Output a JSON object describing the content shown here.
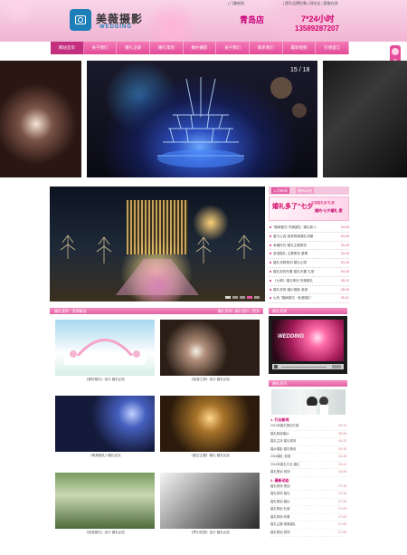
{
  "header": {
    "brand_cn": "美薇摄影",
    "brand_en": "WEDDING",
    "top_link": "| 门最新网",
    "top_right": "| 提升品牌形象 | 网站全 | 客服在线",
    "store": "青岛店",
    "hotline_label": "7*24小时",
    "hotline_number": "13589287207"
  },
  "nav": [
    "网站首页",
    "关于我们",
    "婚礼记录",
    "婚礼策划",
    "婚纱摄影",
    "关于我们",
    "联系我们",
    "最新视频",
    "在线留言"
  ],
  "side_float": {
    "label": "在线客服"
  },
  "gallery": {
    "counter": "15 / 18"
  },
  "right_tabs": [
    "公司新闻",
    "最新动态"
  ],
  "promo": {
    "main": "婚礼多了\"七夕",
    "sub": "中国婚礼新\"礼服",
    "tag": "婚约·七夕婚礼·爱"
  },
  "news": [
    {
      "title": "\"婚嫁盛况·完美婚礼\" 婚礼新人",
      "date": "04-26"
    },
    {
      "title": "爱与心连·浪漫唯美婚礼场景",
      "date": "04-20"
    },
    {
      "title": "幸福时光·婚礼主题策划",
      "date": "04-18"
    },
    {
      "title": "浪漫婚礼·主题策划 爱情",
      "date": "04-16"
    },
    {
      "title": "婚礼流程策划·婚礼记录",
      "date": "04-15"
    },
    {
      "title": "婚礼现场布置·婚礼布置 礼堂",
      "date": "04-15"
    },
    {
      "title": "《大美》婚礼策划 完美婚礼",
      "date": "05-11"
    },
    {
      "title": "婚礼现场·婚纱摄影 浪漫",
      "date": "05-03"
    },
    {
      "title": "火热 \"婚嫁盛况 · 浪漫婚礼\"",
      "date": "05-01"
    }
  ],
  "cases": {
    "title": "婚礼案例 · 案例精选",
    "tabs": [
      "婚礼案例",
      "婚礼图片",
      "更多"
    ],
    "items": [
      {
        "caption": "《美好婚礼》设计·婚礼纪实"
      },
      {
        "caption": "《浪漫之夜》设计·婚礼纪实"
      },
      {
        "caption": "《唯美婚礼》·婚礼纪实"
      },
      {
        "caption": "《星空主题》婚礼·婚礼纪实"
      },
      {
        "caption": "《浪漫婚礼》设计·婚礼纪实"
      },
      {
        "caption": "《梦幻花园》设计·婚礼纪实"
      }
    ]
  },
  "video": {
    "title": "婚礼视频",
    "label": "WEDDING"
  },
  "right_panel": {
    "title": "婚礼资讯",
    "groups": [
      {
        "heading": "1. 行业新闻",
        "items": [
          {
            "title": "2013年婚礼策划方案",
            "date": "09-12"
          },
          {
            "title": "婚礼精品婚纱",
            "date": "06-26"
          },
          {
            "title": "婚礼主持·婚礼现场",
            "date": "04-23"
          },
          {
            "title": "婚纱摄影·婚礼策划",
            "date": "04-19"
          },
          {
            "title": "2016婚礼·浪漫",
            "date": "04-16"
          },
          {
            "title": "2016年婚礼行业·婚礼",
            "date": "04-12"
          },
          {
            "title": "婚礼策划·现场",
            "date": "04-09"
          }
        ]
      },
      {
        "heading": "2. 最新动态",
        "items": [
          {
            "title": "婚礼现场·策划",
            "date": "07-15"
          },
          {
            "title": "婚礼现场·婚礼",
            "date": "07-14"
          },
          {
            "title": "婚礼策划·婚纱",
            "date": "07-09"
          },
          {
            "title": "婚礼策划·礼服",
            "date": "07-09"
          },
          {
            "title": "婚礼现场·布置",
            "date": "07-09"
          },
          {
            "title": "婚礼主题·唯美婚礼",
            "date": "07-08"
          },
          {
            "title": "婚礼策划·现场",
            "date": "07-08"
          }
        ]
      }
    ]
  }
}
